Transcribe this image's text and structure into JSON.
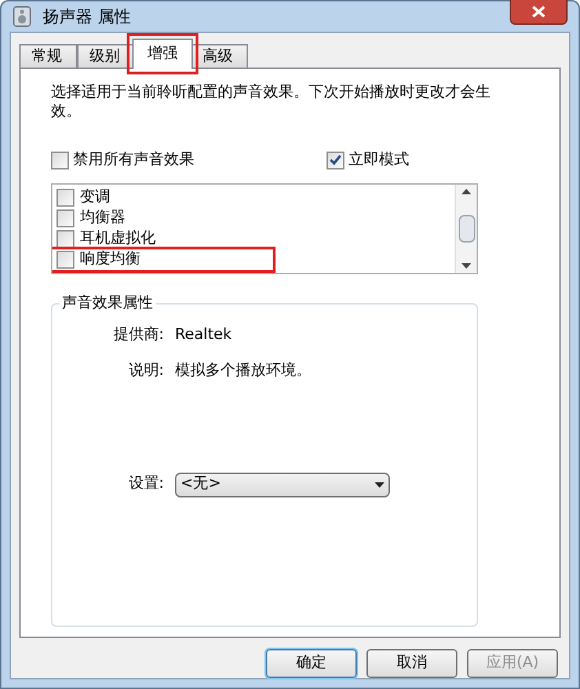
{
  "window": {
    "title": "扬声器 属性"
  },
  "tabs": [
    {
      "label": "常规",
      "selected": false,
      "highlighted": false
    },
    {
      "label": "级别",
      "selected": false,
      "highlighted": false
    },
    {
      "label": "增强",
      "selected": true,
      "highlighted": true
    },
    {
      "label": "高级",
      "selected": false,
      "highlighted": false
    }
  ],
  "description": "选择适用于当前聆听配置的声音效果。下次开始播放时更改才会生效。",
  "options": [
    {
      "label": "禁用所有声音效果",
      "checked": false
    },
    {
      "label": "立即模式",
      "checked": true
    }
  ],
  "effects": [
    {
      "label": "变调",
      "checked": false,
      "highlighted": false
    },
    {
      "label": "均衡器",
      "checked": false,
      "highlighted": false
    },
    {
      "label": "耳机虚拟化",
      "checked": false,
      "highlighted": false
    },
    {
      "label": "响度均衡",
      "checked": false,
      "highlighted": true
    }
  ],
  "properties": {
    "title": "声音效果属性",
    "rows": [
      {
        "label": "提供商:",
        "value": "Realtek"
      },
      {
        "label": "说明:",
        "value": "模拟多个播放环境。"
      }
    ],
    "setting": {
      "label": "设置:",
      "value": "<无>"
    }
  },
  "buttons": [
    {
      "label": "确定",
      "disabled": false,
      "default": true
    },
    {
      "label": "取消",
      "disabled": false,
      "default": false
    },
    {
      "label": "应用(A)",
      "disabled": true,
      "default": false
    }
  ]
}
